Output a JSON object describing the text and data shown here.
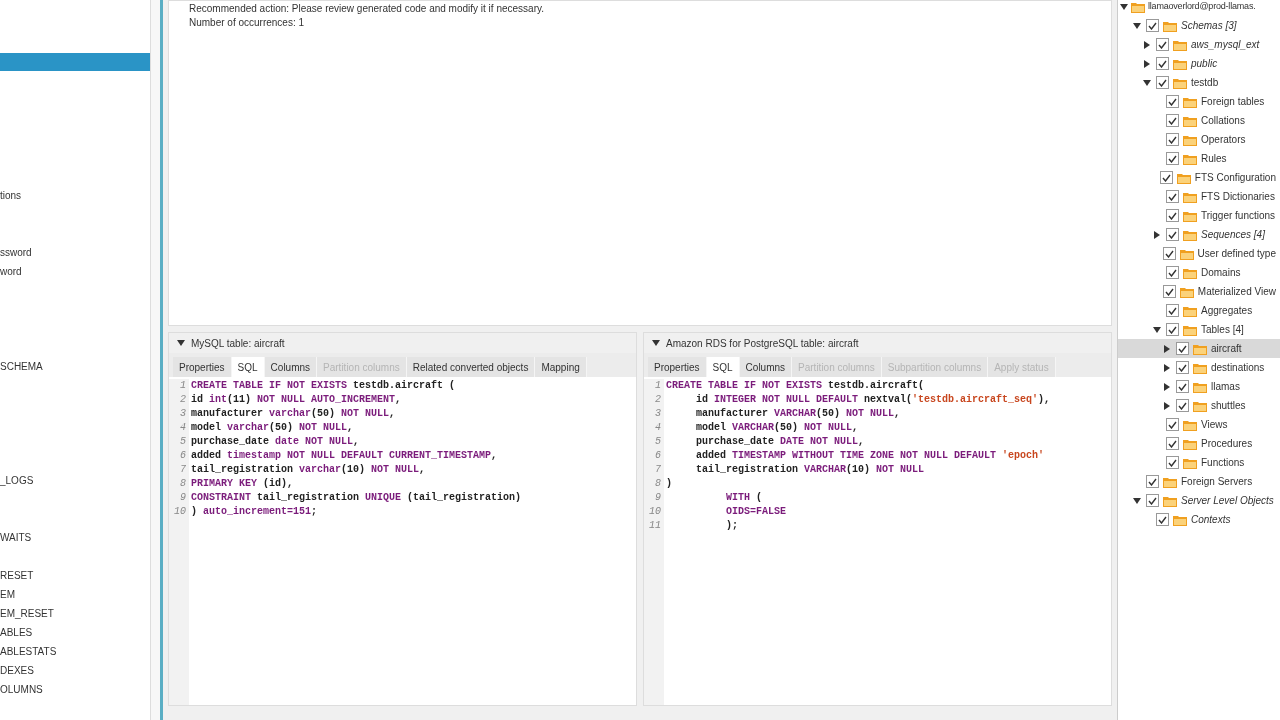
{
  "left_list": {
    "items": [
      "tions",
      "ssword",
      "word",
      "SCHEMA",
      "_LOGS",
      "WAITS",
      "RESET",
      "EM",
      "EM_RESET",
      "ABLES",
      "ABLESTATS",
      "DEXES",
      "OLUMNS"
    ]
  },
  "message": [
    "Recommended action: Please review generated code and modify it if necessary.",
    "Number of occurrences: 1"
  ],
  "panels": [
    {
      "title": "MySQL table: aircraft",
      "expanded": true,
      "tabs": [
        {
          "label": "Properties",
          "selected": false,
          "disabled": false
        },
        {
          "label": "SQL",
          "selected": true,
          "disabled": false
        },
        {
          "label": "Columns",
          "selected": false,
          "disabled": false
        },
        {
          "label": "Partition columns",
          "selected": false,
          "disabled": true
        },
        {
          "label": "Related converted objects",
          "selected": false,
          "disabled": false
        },
        {
          "label": "Mapping",
          "selected": false,
          "disabled": false
        }
      ],
      "lines": [
        {
          "number": "1",
          "tokens": [
            {
              "kind": "kw",
              "text": "CREATE TABLE IF NOT EXISTS "
            },
            {
              "kind": "id",
              "text": "testdb.aircraft ("
            }
          ]
        },
        {
          "number": "2",
          "tokens": [
            {
              "kind": "id",
              "text": "id "
            },
            {
              "kind": "kw",
              "text": "int"
            },
            {
              "kind": "id",
              "text": "(11) "
            },
            {
              "kind": "kw",
              "text": "NOT NULL AUTO_INCREMENT"
            },
            {
              "kind": "id",
              "text": ","
            }
          ]
        },
        {
          "number": "3",
          "tokens": [
            {
              "kind": "id",
              "text": "manufacturer "
            },
            {
              "kind": "kw",
              "text": "varchar"
            },
            {
              "kind": "id",
              "text": "(50) "
            },
            {
              "kind": "kw",
              "text": "NOT NULL"
            },
            {
              "kind": "id",
              "text": ","
            }
          ]
        },
        {
          "number": "4",
          "tokens": [
            {
              "kind": "id",
              "text": "model "
            },
            {
              "kind": "kw",
              "text": "varchar"
            },
            {
              "kind": "id",
              "text": "(50) "
            },
            {
              "kind": "kw",
              "text": "NOT NULL"
            },
            {
              "kind": "id",
              "text": ","
            }
          ]
        },
        {
          "number": "5",
          "tokens": [
            {
              "kind": "id",
              "text": "purchase_date "
            },
            {
              "kind": "kw",
              "text": "date NOT NULL"
            },
            {
              "kind": "id",
              "text": ","
            }
          ]
        },
        {
          "number": "6",
          "tokens": [
            {
              "kind": "id",
              "text": "added "
            },
            {
              "kind": "kw",
              "text": "timestamp NOT NULL DEFAULT CURRENT_TIMESTAMP"
            },
            {
              "kind": "id",
              "text": ","
            }
          ]
        },
        {
          "number": "7",
          "tokens": [
            {
              "kind": "id",
              "text": "tail_registration "
            },
            {
              "kind": "kw",
              "text": "varchar"
            },
            {
              "kind": "id",
              "text": "(10) "
            },
            {
              "kind": "kw",
              "text": "NOT NULL"
            },
            {
              "kind": "id",
              "text": ","
            }
          ]
        },
        {
          "number": "8",
          "tokens": [
            {
              "kind": "kw",
              "text": "PRIMARY KEY "
            },
            {
              "kind": "id",
              "text": "(id),"
            }
          ]
        },
        {
          "number": "9",
          "tokens": [
            {
              "kind": "kw",
              "text": "CONSTRAINT "
            },
            {
              "kind": "id",
              "text": "tail_registration "
            },
            {
              "kind": "kw",
              "text": "UNIQUE "
            },
            {
              "kind": "id",
              "text": "(tail_registration)"
            }
          ]
        },
        {
          "number": "10",
          "tokens": [
            {
              "kind": "id",
              "text": ") "
            },
            {
              "kind": "kw",
              "text": "auto_increment=151"
            },
            {
              "kind": "id",
              "text": ";"
            }
          ]
        }
      ]
    },
    {
      "title": "Amazon RDS for PostgreSQL table: aircraft",
      "expanded": true,
      "tabs": [
        {
          "label": "Properties",
          "selected": false,
          "disabled": false
        },
        {
          "label": "SQL",
          "selected": true,
          "disabled": false
        },
        {
          "label": "Columns",
          "selected": false,
          "disabled": false
        },
        {
          "label": "Partition columns",
          "selected": false,
          "disabled": true
        },
        {
          "label": "Subpartition columns",
          "selected": false,
          "disabled": true
        },
        {
          "label": "Apply status",
          "selected": false,
          "disabled": true
        }
      ],
      "lines": [
        {
          "number": "1",
          "tokens": [
            {
              "kind": "kw",
              "text": "CREATE TABLE IF NOT EXISTS "
            },
            {
              "kind": "id",
              "text": "testdb.aircraft("
            }
          ]
        },
        {
          "number": "2",
          "tokens": [
            {
              "kind": "id",
              "text": "     id "
            },
            {
              "kind": "kw",
              "text": "INTEGER NOT NULL DEFAULT "
            },
            {
              "kind": "id",
              "text": "nextval("
            },
            {
              "kind": "str",
              "text": "'testdb.aircraft_seq'"
            },
            {
              "kind": "id",
              "text": "),"
            }
          ]
        },
        {
          "number": "3",
          "tokens": [
            {
              "kind": "id",
              "text": "     manufacturer "
            },
            {
              "kind": "kw",
              "text": "VARCHAR"
            },
            {
              "kind": "id",
              "text": "(50) "
            },
            {
              "kind": "kw",
              "text": "NOT NULL"
            },
            {
              "kind": "id",
              "text": ","
            }
          ]
        },
        {
          "number": "4",
          "tokens": [
            {
              "kind": "id",
              "text": "     model "
            },
            {
              "kind": "kw",
              "text": "VARCHAR"
            },
            {
              "kind": "id",
              "text": "(50) "
            },
            {
              "kind": "kw",
              "text": "NOT NULL"
            },
            {
              "kind": "id",
              "text": ","
            }
          ]
        },
        {
          "number": "5",
          "tokens": [
            {
              "kind": "id",
              "text": "     purchase_date "
            },
            {
              "kind": "kw",
              "text": "DATE NOT NULL"
            },
            {
              "kind": "id",
              "text": ","
            }
          ]
        },
        {
          "number": "6",
          "tokens": [
            {
              "kind": "id",
              "text": "     added "
            },
            {
              "kind": "kw",
              "text": "TIMESTAMP WITHOUT TIME ZONE NOT NULL DEFAULT "
            },
            {
              "kind": "str",
              "text": "'epoch'"
            }
          ]
        },
        {
          "number": "7",
          "tokens": [
            {
              "kind": "id",
              "text": "     tail_registration "
            },
            {
              "kind": "kw",
              "text": "VARCHAR"
            },
            {
              "kind": "id",
              "text": "(10) "
            },
            {
              "kind": "kw",
              "text": "NOT NULL"
            }
          ]
        },
        {
          "number": "8",
          "tokens": [
            {
              "kind": "id",
              "text": ")"
            }
          ]
        },
        {
          "number": "9",
          "tokens": [
            {
              "kind": "kw",
              "text": "          WITH "
            },
            {
              "kind": "id",
              "text": "("
            }
          ]
        },
        {
          "number": "10",
          "tokens": [
            {
              "kind": "kw",
              "text": "          OIDS=FALSE"
            }
          ]
        },
        {
          "number": "11",
          "tokens": [
            {
              "kind": "id",
              "text": "          );"
            }
          ]
        }
      ]
    }
  ],
  "tree": {
    "label": "llamaoverlord@prod-llamas.",
    "expanded": true,
    "children": [
      {
        "label": "Schemas [3]",
        "italic": true,
        "checked": true,
        "expanded": true,
        "selected": false,
        "children": [
          {
            "label": "aws_mysql_ext",
            "italic": true,
            "checked": true,
            "expanded": false,
            "selected": false
          },
          {
            "label": "public",
            "italic": true,
            "checked": true,
            "expanded": false,
            "selected": false
          },
          {
            "label": "testdb",
            "italic": false,
            "checked": true,
            "expanded": true,
            "selected": false,
            "children": [
              {
                "label": "Foreign tables",
                "italic": false,
                "checked": true,
                "selected": false
              },
              {
                "label": "Collations",
                "italic": false,
                "checked": true,
                "selected": false
              },
              {
                "label": "Operators",
                "italic": false,
                "checked": true,
                "selected": false
              },
              {
                "label": "Rules",
                "italic": false,
                "checked": true,
                "selected": false
              },
              {
                "label": "FTS Configuration",
                "italic": false,
                "checked": true,
                "selected": false
              },
              {
                "label": "FTS Dictionaries",
                "italic": false,
                "checked": true,
                "selected": false
              },
              {
                "label": "Trigger functions",
                "italic": false,
                "checked": true,
                "selected": false
              },
              {
                "label": "Sequences [4]",
                "italic": true,
                "checked": true,
                "expanded": false,
                "selected": false
              },
              {
                "label": "User defined type",
                "italic": false,
                "checked": true,
                "selected": false
              },
              {
                "label": "Domains",
                "italic": false,
                "checked": true,
                "selected": false
              },
              {
                "label": "Materialized View",
                "italic": false,
                "checked": true,
                "selected": false
              },
              {
                "label": "Aggregates",
                "italic": false,
                "checked": true,
                "selected": false
              },
              {
                "label": "Tables [4]",
                "italic": false,
                "checked": true,
                "expanded": true,
                "selected": false,
                "children": [
                  {
                    "label": "aircraft",
                    "italic": false,
                    "checked": true,
                    "expanded": false,
                    "selected": true
                  },
                  {
                    "label": "destinations",
                    "italic": false,
                    "checked": true,
                    "expanded": false,
                    "selected": false
                  },
                  {
                    "label": "llamas",
                    "italic": false,
                    "checked": true,
                    "expanded": false,
                    "selected": false
                  },
                  {
                    "label": "shuttles",
                    "italic": false,
                    "checked": true,
                    "expanded": false,
                    "selected": false
                  }
                ]
              },
              {
                "label": "Views",
                "italic": false,
                "checked": true,
                "selected": false
              },
              {
                "label": "Procedures",
                "italic": false,
                "checked": true,
                "selected": false
              },
              {
                "label": "Functions",
                "italic": false,
                "checked": true,
                "selected": false
              }
            ]
          }
        ]
      },
      {
        "label": "Foreign Servers",
        "italic": false,
        "checked": true,
        "selected": false
      },
      {
        "label": "Server Level Objects",
        "italic": true,
        "checked": true,
        "expanded": true,
        "selected": false,
        "children": [
          {
            "label": "Contexts",
            "italic": true,
            "checked": true,
            "selected": false
          }
        ]
      }
    ]
  }
}
